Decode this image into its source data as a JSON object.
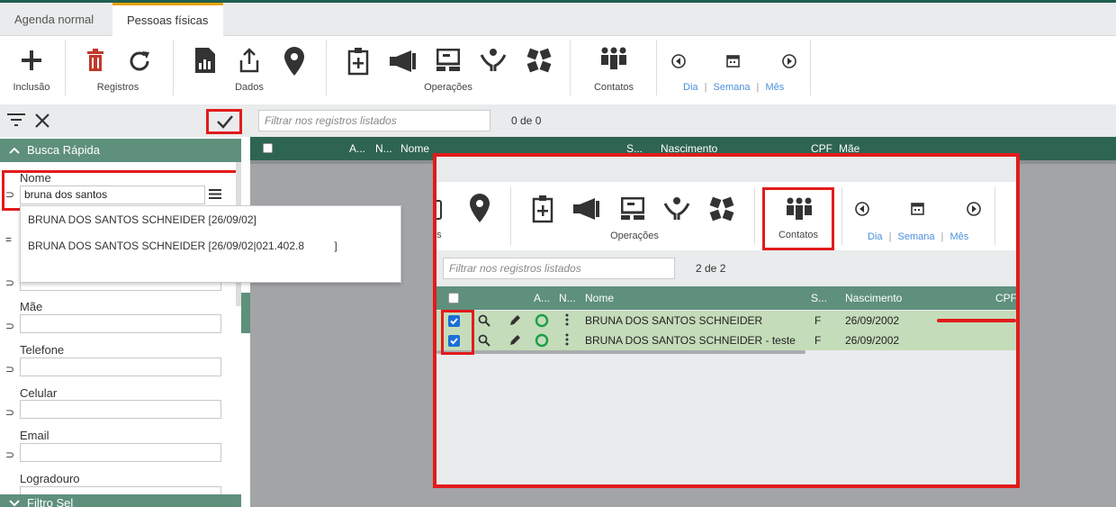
{
  "tabs": [
    {
      "label": "Agenda normal",
      "active": false
    },
    {
      "label": "Pessoas físicas",
      "active": true
    }
  ],
  "toolbar": {
    "inclusao": "Inclusão",
    "registros": "Registros",
    "dados": "Dados",
    "operacoes": "Operações",
    "contatos": "Contatos",
    "dia": "Dia",
    "semana": "Semana",
    "mes": "Mês",
    "sep": "|"
  },
  "left": {
    "busca_title": "Busca Rápida",
    "filtro_title": "Filtro Sel",
    "fields": {
      "nome_label": "Nome",
      "nome_value": "bruna dos santos",
      "mae_label": "Mãe",
      "telefone_label": "Telefone",
      "celular_label": "Celular",
      "email_label": "Email",
      "logradouro_label": "Logradouro"
    },
    "op_symbol": "⊃",
    "eq_symbol": "="
  },
  "dropdown": {
    "items": [
      "BRUNA DOS SANTOS SCHNEIDER [26/09/02]",
      "BRUNA DOS SANTOS SCHNEIDER [26/09/02|021.402.8          ]"
    ]
  },
  "main": {
    "filter_placeholder": "Filtrar nos registros listados",
    "count": "0 de 0",
    "columns": {
      "a": "A...",
      "n": "N...",
      "nome": "Nome",
      "s": "S...",
      "nascimento": "Nascimento",
      "cpf": "CPF",
      "mae": "Mãe"
    }
  },
  "panel": {
    "dados_partial": "os",
    "operacoes": "Operações",
    "contatos": "Contatos",
    "dia": "Dia",
    "semana": "Semana",
    "mes": "Mês",
    "filter_placeholder": "Filtrar nos registros listados",
    "count": "2 de 2",
    "columns": {
      "a": "A...",
      "n": "N...",
      "nome": "Nome",
      "s": "S...",
      "nascimento": "Nascimento",
      "cpf": "CPF"
    },
    "rows": [
      {
        "nome": "BRUNA DOS SANTOS SCHNEIDER",
        "sexo": "F",
        "nascimento": "26/09/2002",
        "checked": true
      },
      {
        "nome": "BRUNA DOS SANTOS SCHNEIDER - teste",
        "sexo": "F",
        "nascimento": "26/09/2002",
        "checked": true
      }
    ]
  },
  "colors": {
    "accent_green": "#2e6452",
    "section_green": "#5e907c",
    "row_green": "#c4dcba",
    "highlight_red": "#e21b1b",
    "tab_orange": "#e8a200",
    "link_blue": "#4a90d9"
  }
}
